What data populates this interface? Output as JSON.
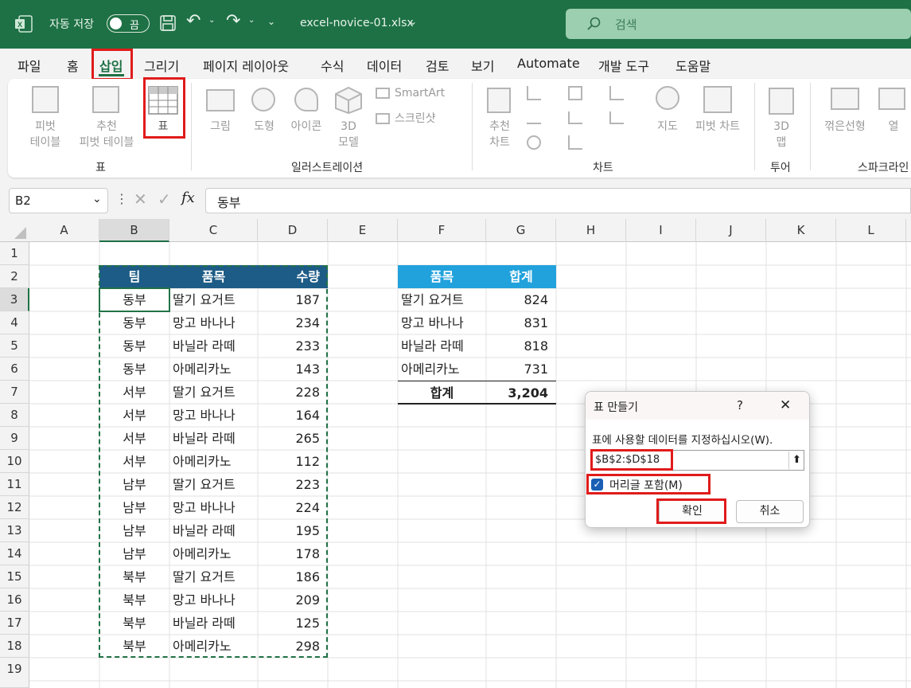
{
  "titlebar": {
    "autosave_label": "자동 저장",
    "autosave_state": "끔",
    "filename": "excel-novice-01.xlsx",
    "search_placeholder": "검색"
  },
  "tabs": [
    "파일",
    "홈",
    "삽입",
    "그리기",
    "페이지 레이아웃",
    "수식",
    "데이터",
    "검토",
    "보기",
    "Automate",
    "개발 도구",
    "도움말"
  ],
  "ribbon": {
    "pivot_table": "피벗\n테이블",
    "recommended_pivot": "추천\n피벗 테이블",
    "table": "표",
    "picture": "그림",
    "shapes": "도형",
    "icons": "아이콘",
    "models_3d": "3D\n모델",
    "smartart": "SmartArt",
    "screenshot": "스크린샷",
    "recommended_charts": "추천\n차트",
    "maps": "지도",
    "pivot_chart": "피벗 차트",
    "map_3d": "3D\n맵",
    "sparkline_line": "꺾은선형",
    "sparkline_column": "열",
    "groups": {
      "tables": "표",
      "illustrations": "일러스트레이션",
      "charts": "차트",
      "tours": "투어",
      "sparklines": "스파크라인"
    }
  },
  "formula_bar": {
    "name_box": "B2",
    "content": "동부",
    "fx": "fx"
  },
  "columns": [
    "A",
    "B",
    "C",
    "D",
    "E",
    "F",
    "G",
    "H",
    "I",
    "J",
    "K",
    "L"
  ],
  "rows": [
    "1",
    "2",
    "3",
    "4",
    "5",
    "6",
    "7",
    "8",
    "9",
    "10",
    "11",
    "12",
    "13",
    "14",
    "15",
    "16",
    "17",
    "18",
    "19"
  ],
  "data_table": {
    "headers": [
      "팀",
      "품목",
      "수량"
    ],
    "rows": [
      [
        "동부",
        "딸기 요거트",
        "187"
      ],
      [
        "동부",
        "망고 바나나",
        "234"
      ],
      [
        "동부",
        "바닐라 라떼",
        "233"
      ],
      [
        "동부",
        "아메리카노",
        "143"
      ],
      [
        "서부",
        "딸기 요거트",
        "228"
      ],
      [
        "서부",
        "망고 바나나",
        "164"
      ],
      [
        "서부",
        "바닐라 라떼",
        "265"
      ],
      [
        "서부",
        "아메리카노",
        "112"
      ],
      [
        "남부",
        "딸기 요거트",
        "223"
      ],
      [
        "남부",
        "망고 바나나",
        "224"
      ],
      [
        "남부",
        "바닐라 라떼",
        "195"
      ],
      [
        "남부",
        "아메리카노",
        "178"
      ],
      [
        "북부",
        "딸기 요거트",
        "186"
      ],
      [
        "북부",
        "망고 바나나",
        "209"
      ],
      [
        "북부",
        "바닐라 라떼",
        "125"
      ],
      [
        "북부",
        "아메리카노",
        "298"
      ]
    ]
  },
  "summary_table": {
    "headers": [
      "품목",
      "합계"
    ],
    "rows": [
      [
        "딸기 요거트",
        "824"
      ],
      [
        "망고 바나나",
        "831"
      ],
      [
        "바닐라 라떼",
        "818"
      ],
      [
        "아메리카노",
        "731"
      ]
    ],
    "total_label": "합계",
    "total_value": "3,204"
  },
  "dialog": {
    "title": "표 만들기",
    "help": "?",
    "close": "✕",
    "prompt": "표에 사용할 데이터를 지정하십시오(W).",
    "range": "$B$2:$D$18",
    "header_checkbox_label": "머리글 포함(M)",
    "header_checked": true,
    "ok": "확인",
    "cancel": "취소"
  },
  "colors": {
    "title_green": "#1e7145",
    "table_header": "#1d5c86",
    "summary_header": "#22a2dc",
    "highlight_red": "#e01b1b",
    "marquee_green": "#217346"
  }
}
